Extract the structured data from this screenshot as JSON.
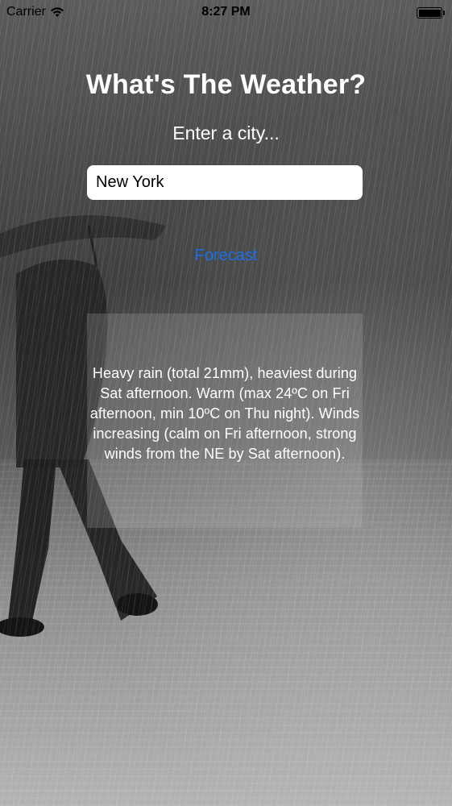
{
  "status_bar": {
    "carrier": "Carrier",
    "time": "8:27 PM",
    "battery_level": 1.0,
    "icons": [
      "wifi-icon",
      "battery-icon"
    ]
  },
  "app": {
    "title": "What's The Weather?",
    "subtitle": "Enter a city...",
    "city_input": {
      "value": "New York",
      "placeholder": ""
    },
    "forecast_button_label": "Forecast",
    "forecast_text": "Heavy rain (total 21mm), heaviest during Sat afternoon. Warm (max 24ºC on Fri afternoon, min 10ºC on Thu night). Winds increasing (calm on Fri afternoon, strong winds from the NE by Sat afternoon)."
  },
  "colors": {
    "button_text": "#1a6fe6",
    "text": "#ffffff",
    "status_text": "#000000"
  }
}
